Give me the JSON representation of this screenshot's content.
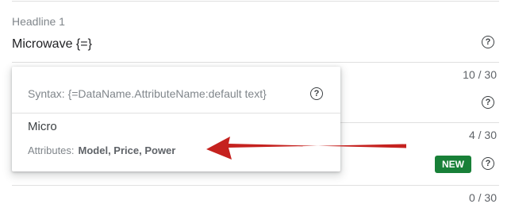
{
  "headline": {
    "label": "Headline 1",
    "value": "Microwave {=}",
    "help_glyph": "?"
  },
  "counters": [
    "10 / 30",
    "4 / 30",
    "0 / 30"
  ],
  "autocomplete": {
    "syntax": "Syntax: {=DataName.AttributeName:default text}",
    "suggestion": "Micro",
    "attributes_label": "Attributes:",
    "attributes": "Model, Price, Power"
  },
  "badge": {
    "label": "NEW",
    "color": "#188038"
  },
  "colors": {
    "annotation_arrow": "#c5221f"
  }
}
